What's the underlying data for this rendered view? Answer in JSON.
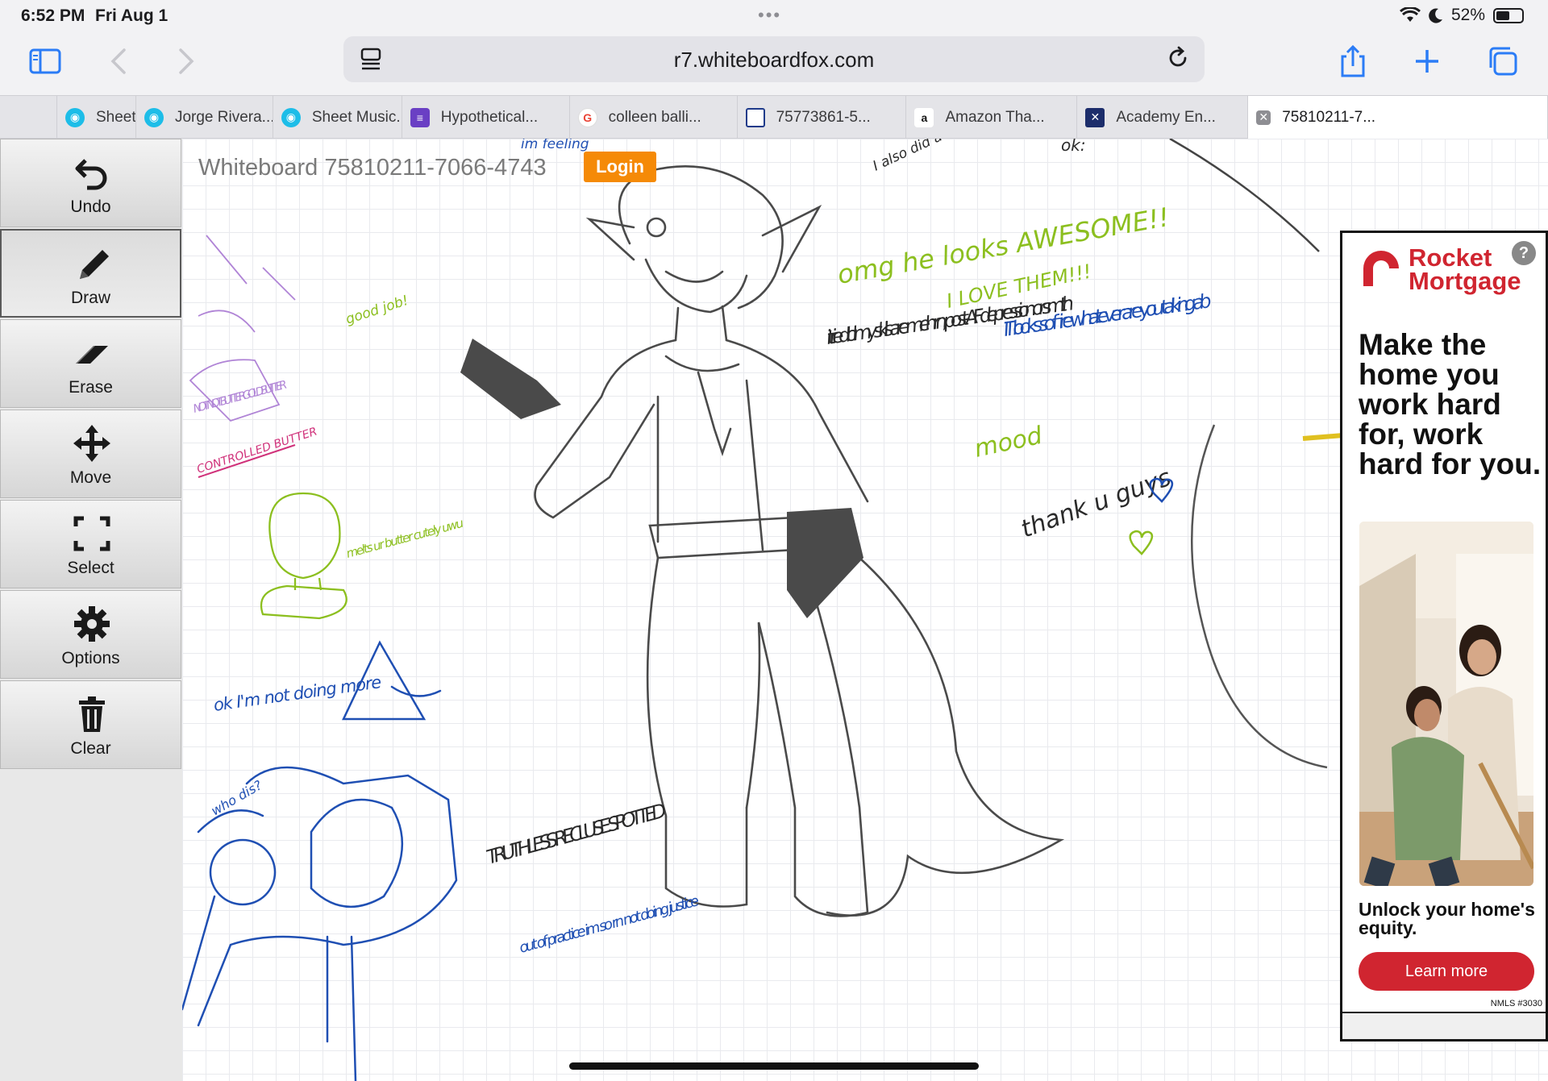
{
  "status_bar": {
    "time": "6:52 PM",
    "date": "Fri Aug 1",
    "battery": "52%",
    "battery_level": 0.52
  },
  "toolbar": {
    "url": "r7.whiteboardfox.com",
    "icons": [
      "sidebar-icon",
      "back-icon",
      "forward-icon",
      "share-icon",
      "plus-icon",
      "tabs-icon",
      "reload-icon",
      "page-menu-icon"
    ]
  },
  "tabs": [
    {
      "label": "",
      "icon": "whiteboardfox-icon"
    },
    {
      "label": "Sheet I",
      "icon": "whiteboardfox-icon"
    },
    {
      "label": "Jorge Rivera...",
      "icon": "whiteboardfox-icon"
    },
    {
      "label": "Sheet Music...",
      "icon": "whiteboardfox-icon"
    },
    {
      "label": "Hypothetical...",
      "icon": "forms-icon"
    },
    {
      "label": "colleen balli...",
      "icon": "google-icon"
    },
    {
      "label": "75773861-5...",
      "icon": "whiteboard-icon"
    },
    {
      "label": "Amazon Tha...",
      "icon": "amazon-icon"
    },
    {
      "label": "Academy En...",
      "icon": "academy-icon"
    },
    {
      "label": "75810211-7...",
      "icon": "close-icon"
    }
  ],
  "board": {
    "title": "Whiteboard 75810211-7066-4743",
    "login_label": "Login"
  },
  "tools": [
    {
      "label": "Undo",
      "icon": "undo-icon"
    },
    {
      "label": "Draw",
      "icon": "pencil-icon",
      "selected": true
    },
    {
      "label": "Erase",
      "icon": "eraser-icon"
    },
    {
      "label": "Move",
      "icon": "move-arrows-icon"
    },
    {
      "label": "Select",
      "icon": "select-frame-icon"
    },
    {
      "label": "Options",
      "icon": "gear-icon"
    },
    {
      "label": "Clear",
      "icon": "trash-icon"
    }
  ],
  "handwriting": [
    {
      "text": "im feeling",
      "color": "#1f4fb3"
    },
    {
      "text": "I also did a ton of gradient : get bored",
      "color": "#2a2a2a"
    },
    {
      "text": "ok:",
      "color": "#2a2a2a"
    },
    {
      "text": "omg he looks AWESOME!!",
      "color": "#8cbf1f"
    },
    {
      "text": "I LOVE THEM!!!",
      "color": "#8cbf1f"
    },
    {
      "text": "i tried lol my skills are meh rn, post-AF depression or smth",
      "color": "#2a2a2a"
    },
    {
      "text": "IT looks so fire whatever are you talking ab",
      "color": "#1f4fb3"
    },
    {
      "text": "mood",
      "color": "#8cbf1f"
    },
    {
      "text": "thank u guys",
      "color": "#2a2a2a"
    },
    {
      "text": "good job!",
      "color": "#8cbf1f"
    },
    {
      "text": "NOT NOT BUTTER GOLD BUTTER",
      "color": "#b084d6"
    },
    {
      "text": "CONTROLLED BUTTER",
      "color": "#d0317a"
    },
    {
      "text": "melts ur butter cutely uwu",
      "color": "#8cbf1f"
    },
    {
      "text": "ok I'm not doing more",
      "color": "#1f4fb3"
    },
    {
      "text": "who dis?",
      "color": "#1f4fb3"
    },
    {
      "text": "TRUTHLESS RECLUSE SPOTTED",
      "color": "#2a2a2a"
    },
    {
      "text": "out of practice im so rn not doing justice",
      "color": "#1f4fb3"
    }
  ],
  "ad": {
    "brand_line1": "Rocket",
    "brand_line2": "Mortgage",
    "info": "?",
    "headline": "Make the home you work hard for, work hard for you.",
    "sub": "Unlock your home's equity.",
    "cta": "Learn more",
    "nmls": "NMLS #3030",
    "brand_color": "#d02530"
  }
}
